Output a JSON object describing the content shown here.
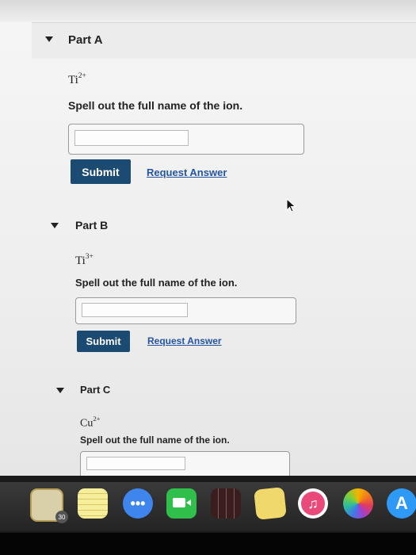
{
  "parts": [
    {
      "title": "Part A",
      "ion_symbol": "Ti",
      "ion_charge": "2+",
      "prompt": "Spell out the full name of the ion.",
      "input_value": "",
      "submit_label": "Submit",
      "request_label": "Request Answer"
    },
    {
      "title": "Part B",
      "ion_symbol": "Ti",
      "ion_charge": "3+",
      "prompt": "Spell out the full name of the ion.",
      "input_value": "",
      "submit_label": "Submit",
      "request_label": "Request Answer"
    },
    {
      "title": "Part C",
      "ion_symbol": "Cu",
      "ion_charge": "2+",
      "prompt": "Spell out the full name of the ion.",
      "input_value": ""
    }
  ],
  "dock": {
    "items": [
      {
        "icon": "preview-icon",
        "color": "#d9cfa8"
      },
      {
        "icon": "notes-icon",
        "color": "#f4e27a"
      },
      {
        "icon": "messages-icon",
        "color": "#3e86ee"
      },
      {
        "icon": "facetime-icon",
        "color": "#2fbf4a"
      },
      {
        "icon": "photo-booth-icon",
        "color": "#5a2a2a"
      },
      {
        "icon": "stickies-icon",
        "color": "#f0d96a"
      },
      {
        "icon": "itunes-icon",
        "color": "#ffffff"
      },
      {
        "icon": "photos-icon",
        "color": "#ffffff"
      },
      {
        "icon": "app-store-icon",
        "color": "#2f9af5"
      }
    ],
    "calendar_badge": "30"
  },
  "colors": {
    "submit_bg": "#1b4b73",
    "link": "#2554a3"
  }
}
